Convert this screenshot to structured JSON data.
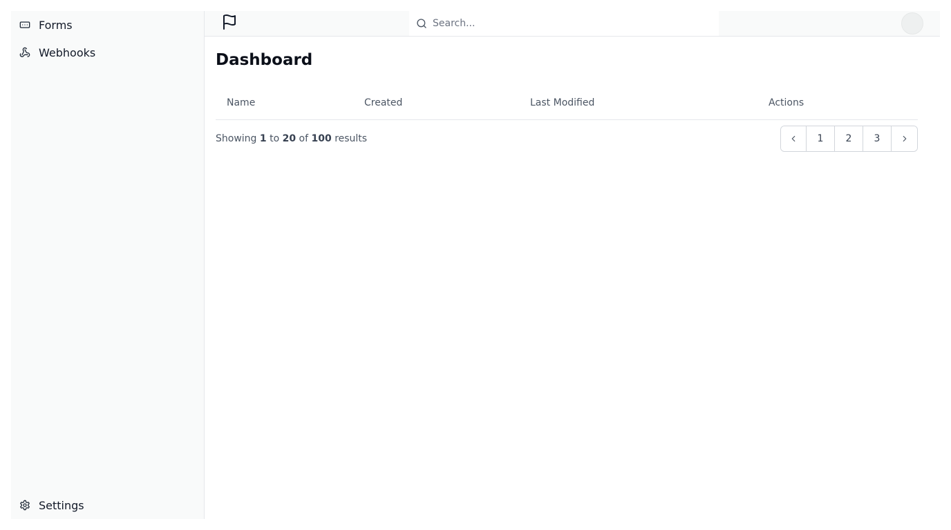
{
  "sidebar": {
    "items": [
      {
        "label": "Forms",
        "icon": "form-input-icon"
      },
      {
        "label": "Webhooks",
        "icon": "webhook-icon"
      }
    ],
    "settings": {
      "label": "Settings",
      "icon": "gear-icon"
    }
  },
  "topbar": {
    "logo_icon": "flag-icon",
    "search": {
      "placeholder": "Search...",
      "value": ""
    }
  },
  "main": {
    "title": "Dashboard",
    "table": {
      "columns": [
        "Name",
        "Created",
        "Last Modified",
        "Actions"
      ],
      "rows": []
    },
    "results": {
      "prefix": "Showing",
      "from": "1",
      "to_word": "to",
      "to": "20",
      "of_word": "of",
      "total": "100",
      "suffix": "results"
    },
    "pagination": {
      "pages": [
        "1",
        "2",
        "3"
      ]
    }
  }
}
